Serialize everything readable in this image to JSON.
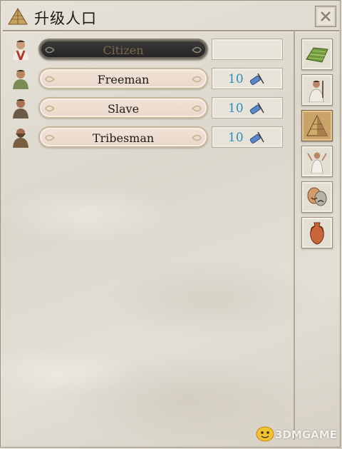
{
  "window": {
    "title": "升级人口",
    "close_icon": "close-x-icon"
  },
  "population": [
    {
      "label": "Citizen",
      "cost": "",
      "state": "disabled",
      "avatar": "citizen-avatar-icon"
    },
    {
      "label": "Freeman",
      "cost": "10",
      "state": "available",
      "avatar": "freeman-avatar-icon"
    },
    {
      "label": "Slave",
      "cost": "10",
      "state": "available",
      "avatar": "slave-avatar-icon"
    },
    {
      "label": "Tribesman",
      "cost": "10",
      "state": "available",
      "avatar": "tribesman-avatar-icon"
    }
  ],
  "cost_icon": "scroll-quill-icon",
  "side_tabs": [
    {
      "name": "land-tab",
      "icon": "farmland-icon",
      "active": false
    },
    {
      "name": "military-tab",
      "icon": "soldier-icon",
      "active": false
    },
    {
      "name": "pyramid-tab",
      "icon": "pyramid-icon",
      "active": true
    },
    {
      "name": "religion-tab",
      "icon": "priest-icon",
      "active": false
    },
    {
      "name": "culture-tab",
      "icon": "theater-masks-icon",
      "active": false
    },
    {
      "name": "trade-tab",
      "icon": "amphora-icon",
      "active": false
    }
  ],
  "watermark": "3DMGAME",
  "colors": {
    "cost_text": "#2b8fc0",
    "disabled_label": "#7b6a4f",
    "active_tab": "#c9a36a"
  }
}
